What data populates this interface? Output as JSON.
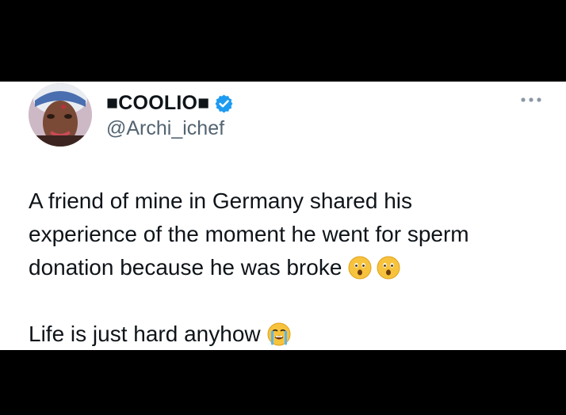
{
  "tweet": {
    "author": {
      "display_name": "■COOLIO■",
      "handle": "@Archi_ichef",
      "verified": true,
      "avatar_icon": "profile-photo"
    },
    "more_icon": "more-dots-icon",
    "lines": [
      "A friend of mine in Germany shared his",
      "experience of the moment he went for sperm",
      "donation because he was broke",
      "",
      "Life is just hard anyhow"
    ],
    "emojis": {
      "line3": [
        "astonished-face-emoji",
        "astonished-face-emoji"
      ],
      "line5": [
        "crying-face-emoji"
      ]
    }
  },
  "colors": {
    "text_primary": "#0f1419",
    "text_secondary": "#536471",
    "verified_blue": "#1d9bf0",
    "background_card": "#ffffff",
    "frame": "#000000"
  }
}
